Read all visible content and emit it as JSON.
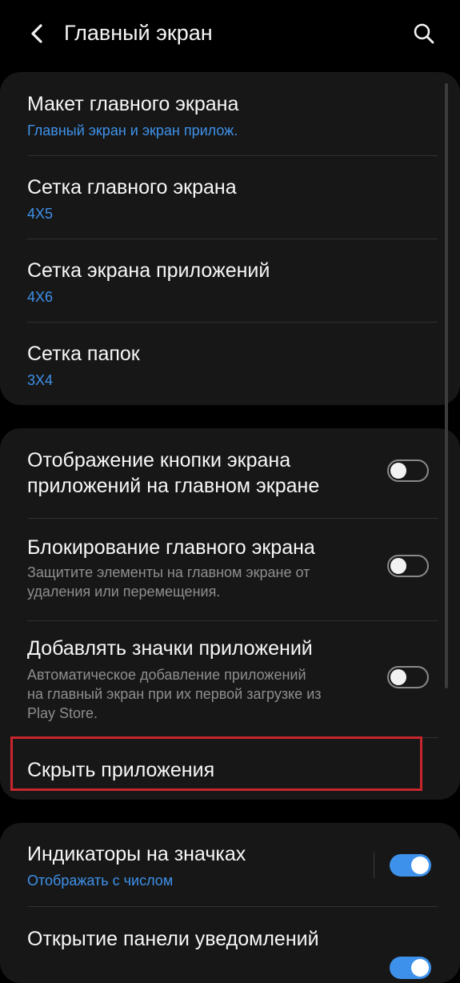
{
  "header": {
    "title": "Главный экран",
    "back_icon": "chevron-left-icon",
    "search_icon": "search-icon"
  },
  "layout_group": {
    "items": [
      {
        "title": "Макет главного экрана",
        "value": "Главный экран и экран прилож."
      },
      {
        "title": "Сетка главного экрана",
        "value": "4X5"
      },
      {
        "title": "Сетка экрана приложений",
        "value": "4X6"
      },
      {
        "title": "Сетка папок",
        "value": "3X4"
      }
    ]
  },
  "options_group": {
    "apps_button": {
      "title_line1": "Отображение кнопки экрана",
      "title_line2": "приложений на главном экране",
      "enabled": false
    },
    "lock_layout": {
      "title": "Блокирование главного экрана",
      "desc_line1": "Защитите элементы на главном экране от",
      "desc_line2": "удаления или перемещения.",
      "enabled": false
    },
    "add_icons": {
      "title": "Добавлять значки приложений",
      "desc_line1": "Автоматическое добавление приложений",
      "desc_line2": "на главный экран при их первой загрузке из",
      "desc_line3": "Play Store.",
      "enabled": false
    },
    "hide_apps": {
      "title": "Скрыть приложения"
    }
  },
  "badges_group": {
    "badges": {
      "title": "Индикаторы на значках",
      "value": "Отображать с числом",
      "enabled": true
    },
    "notification_panel": {
      "title": "Открытие панели уведомлений",
      "enabled": true
    }
  },
  "colors": {
    "accent": "#3e91ea",
    "card_bg": "#171717",
    "highlight": "#c8262c"
  }
}
